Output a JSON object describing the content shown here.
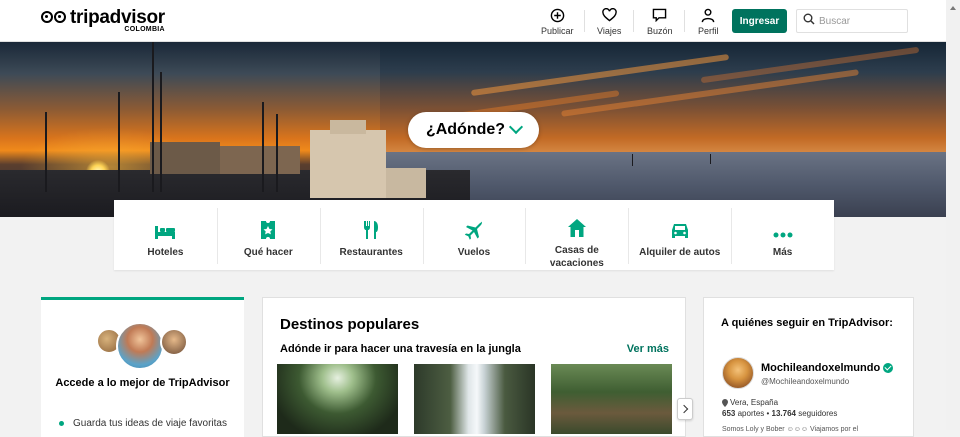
{
  "header": {
    "logo": {
      "name": "tripadvisor",
      "sub": "COLOMBIA",
      "mark": "owl-logo-icon"
    },
    "nav": [
      {
        "label": "Publicar",
        "icon": "plus-circle-icon"
      },
      {
        "label": "Viajes",
        "icon": "heart-icon"
      },
      {
        "label": "Buzón",
        "icon": "message-icon"
      },
      {
        "label": "Perfil",
        "icon": "user-icon"
      }
    ],
    "login_label": "Ingresar",
    "search_placeholder": "Buscar"
  },
  "hero": {
    "where_label": "¿Adónde?"
  },
  "categories": [
    {
      "label": "Hoteles",
      "icon": "bed-icon"
    },
    {
      "label": "Qué hacer",
      "icon": "ticket-icon"
    },
    {
      "label": "Restaurantes",
      "icon": "fork-knife-icon"
    },
    {
      "label": "Vuelos",
      "icon": "plane-icon"
    },
    {
      "label": "Casas de vacaciones",
      "icon": "house-icon"
    },
    {
      "label": "Alquiler de autos",
      "icon": "car-icon"
    },
    {
      "label": "Más",
      "icon": "dots-icon"
    }
  ],
  "join_card": {
    "title": "Accede a lo mejor de TripAdvisor",
    "bullet": "Guarda tus ideas de viaje favoritas"
  },
  "popular": {
    "title": "Destinos populares",
    "subtitle": "Adónde ir para hacer una travesía en la jungla",
    "see_more": "Ver más"
  },
  "follow": {
    "title": "A quiénes seguir en TripAdvisor:",
    "user": {
      "name": "Mochileandoxelmundo",
      "handle": "@Mochileandoxelmundo",
      "location": "Vera, España",
      "contributions": "653",
      "contributions_label": "aportes",
      "followers": "13.764",
      "followers_label": "seguidores",
      "bio": "Somos Loly y Bober ☺☺☺ Viajamos por el"
    }
  },
  "colors": {
    "brand_green": "#00a680",
    "button_green": "#00735e"
  }
}
